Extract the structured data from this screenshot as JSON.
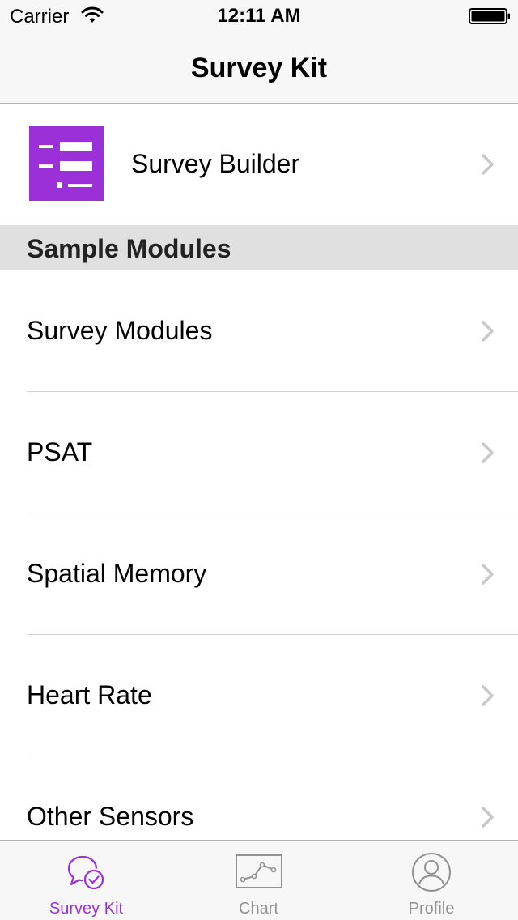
{
  "status_bar": {
    "carrier": "Carrier",
    "time": "12:11 AM"
  },
  "nav": {
    "title": "Survey Kit"
  },
  "builder": {
    "label": "Survey Builder",
    "icon": "survey-builder-icon"
  },
  "section": {
    "title": "Sample Modules"
  },
  "modules": [
    {
      "label": "Survey Modules"
    },
    {
      "label": "PSAT"
    },
    {
      "label": "Spatial Memory"
    },
    {
      "label": "Heart Rate"
    },
    {
      "label": "Other Sensors"
    }
  ],
  "tabs": [
    {
      "label": "Survey Kit",
      "icon": "survey-kit-icon",
      "active": true
    },
    {
      "label": "Chart",
      "icon": "chart-icon",
      "active": false
    },
    {
      "label": "Profile",
      "icon": "profile-icon",
      "active": false
    }
  ],
  "colors": {
    "accent": "#9b30d9",
    "inactive": "#929292",
    "section_bg": "#e0e0e0",
    "bar_bg": "#f7f7f7"
  }
}
